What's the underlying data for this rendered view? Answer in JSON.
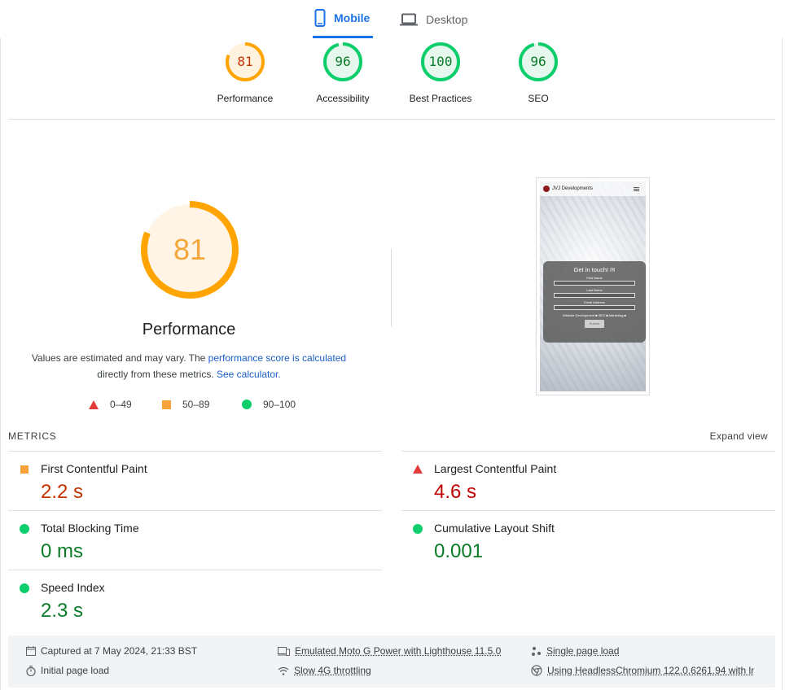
{
  "tabs": {
    "mobile": "Mobile",
    "desktop": "Desktop"
  },
  "categories": [
    {
      "score": "81",
      "label": "Performance",
      "rating": "average"
    },
    {
      "score": "96",
      "label": "Accessibility",
      "rating": "pass"
    },
    {
      "score": "100",
      "label": "Best Practices",
      "rating": "pass"
    },
    {
      "score": "96",
      "label": "SEO",
      "rating": "pass"
    }
  ],
  "performance": {
    "score": "81",
    "progress": 0.81,
    "title": "Performance",
    "desc_prefix": "Values are estimated and may vary. The ",
    "desc_link": "performance score is calculated",
    "desc_middle": "directly from these metrics. ",
    "desc_link2": "See calculator.",
    "legend": {
      "fail": "0–49",
      "average": "50–89",
      "pass": "90–100"
    }
  },
  "screenshot": {
    "site_title": "JVJ Developments",
    "form_title": "Get in touch! ✉",
    "field1": "First Name",
    "field2": "Last Name",
    "field3": "Email Address",
    "checks": "Website Development ■ SEO ■ Marketing ■",
    "submit": "Submit"
  },
  "metrics": {
    "heading": "METRICS",
    "expand": "Expand view",
    "fcp": {
      "name": "First Contentful Paint",
      "value": "2.2 s"
    },
    "lcp": {
      "name": "Largest Contentful Paint",
      "value": "4.6 s"
    },
    "tbt": {
      "name": "Total Blocking Time",
      "value": "0 ms"
    },
    "cls": {
      "name": "Cumulative Layout Shift",
      "value": "0.001"
    },
    "si": {
      "name": "Speed Index",
      "value": "2.3 s"
    }
  },
  "footer": {
    "captured": "Captured at 7 May 2024, 21:33 BST",
    "initial": "Initial page load",
    "device": "Emulated Moto G Power with Lighthouse 11.5.0",
    "throttle": "Slow 4G throttling",
    "single": "Single page load",
    "browser": "Using HeadlessChromium 122.0.6261.94 with lr"
  },
  "colors": {
    "accent": "#1a73e8",
    "average": "#ffa400",
    "pass": "#0cce6b",
    "fail": "#ff4e42"
  }
}
